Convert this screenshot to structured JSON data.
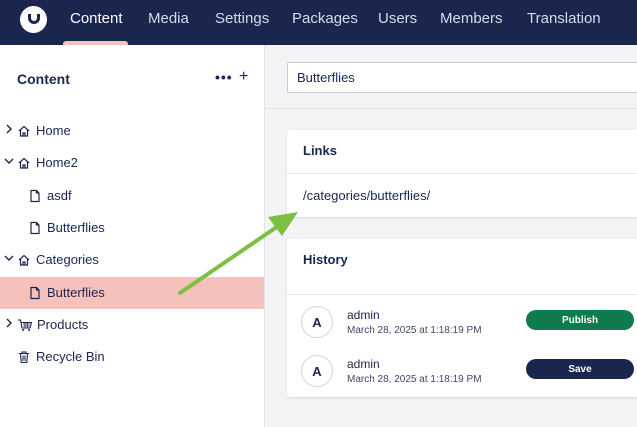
{
  "nav": {
    "logo_icon": "umbraco-logo-icon",
    "items": [
      {
        "label": "Content",
        "active": true
      },
      {
        "label": "Media"
      },
      {
        "label": "Settings"
      },
      {
        "label": "Packages"
      },
      {
        "label": "Users"
      },
      {
        "label": "Members"
      },
      {
        "label": "Translation"
      }
    ]
  },
  "sidebar": {
    "title": "Content",
    "more_label": "•••",
    "add_label": "+",
    "tree": [
      {
        "label": "Home",
        "icon": "home-icon",
        "expander": "chevron-right"
      },
      {
        "label": "Home2",
        "icon": "home-icon",
        "expander": "chevron-down"
      },
      {
        "label": "asdf",
        "icon": "document-icon"
      },
      {
        "label": "Butterflies",
        "icon": "document-icon"
      },
      {
        "label": "Categories",
        "icon": "home-icon",
        "expander": "chevron-down"
      },
      {
        "label": "Butterflies",
        "icon": "document-icon",
        "selected": true
      },
      {
        "label": "Products",
        "icon": "cart-icon",
        "expander": "chevron-right"
      },
      {
        "label": "Recycle Bin",
        "icon": "trash-icon"
      }
    ]
  },
  "editor": {
    "name_value": "Butterflies"
  },
  "links": {
    "title": "Links",
    "url": "/categories/butterflies/"
  },
  "history": {
    "title": "History",
    "entries": [
      {
        "avatar": "A",
        "user": "admin",
        "date": "March 28, 2025 at 1:18:19 PM",
        "action": "Publish",
        "color": "#0e7a4e"
      },
      {
        "avatar": "A",
        "user": "admin",
        "date": "March 28, 2025 at 1:18:19 PM",
        "action": "Save",
        "color": "#1b264f"
      }
    ]
  },
  "colors": {
    "nav_bg": "#1b264f",
    "selected_bg": "#f5c1bc",
    "arrow": "#7cbf43"
  }
}
